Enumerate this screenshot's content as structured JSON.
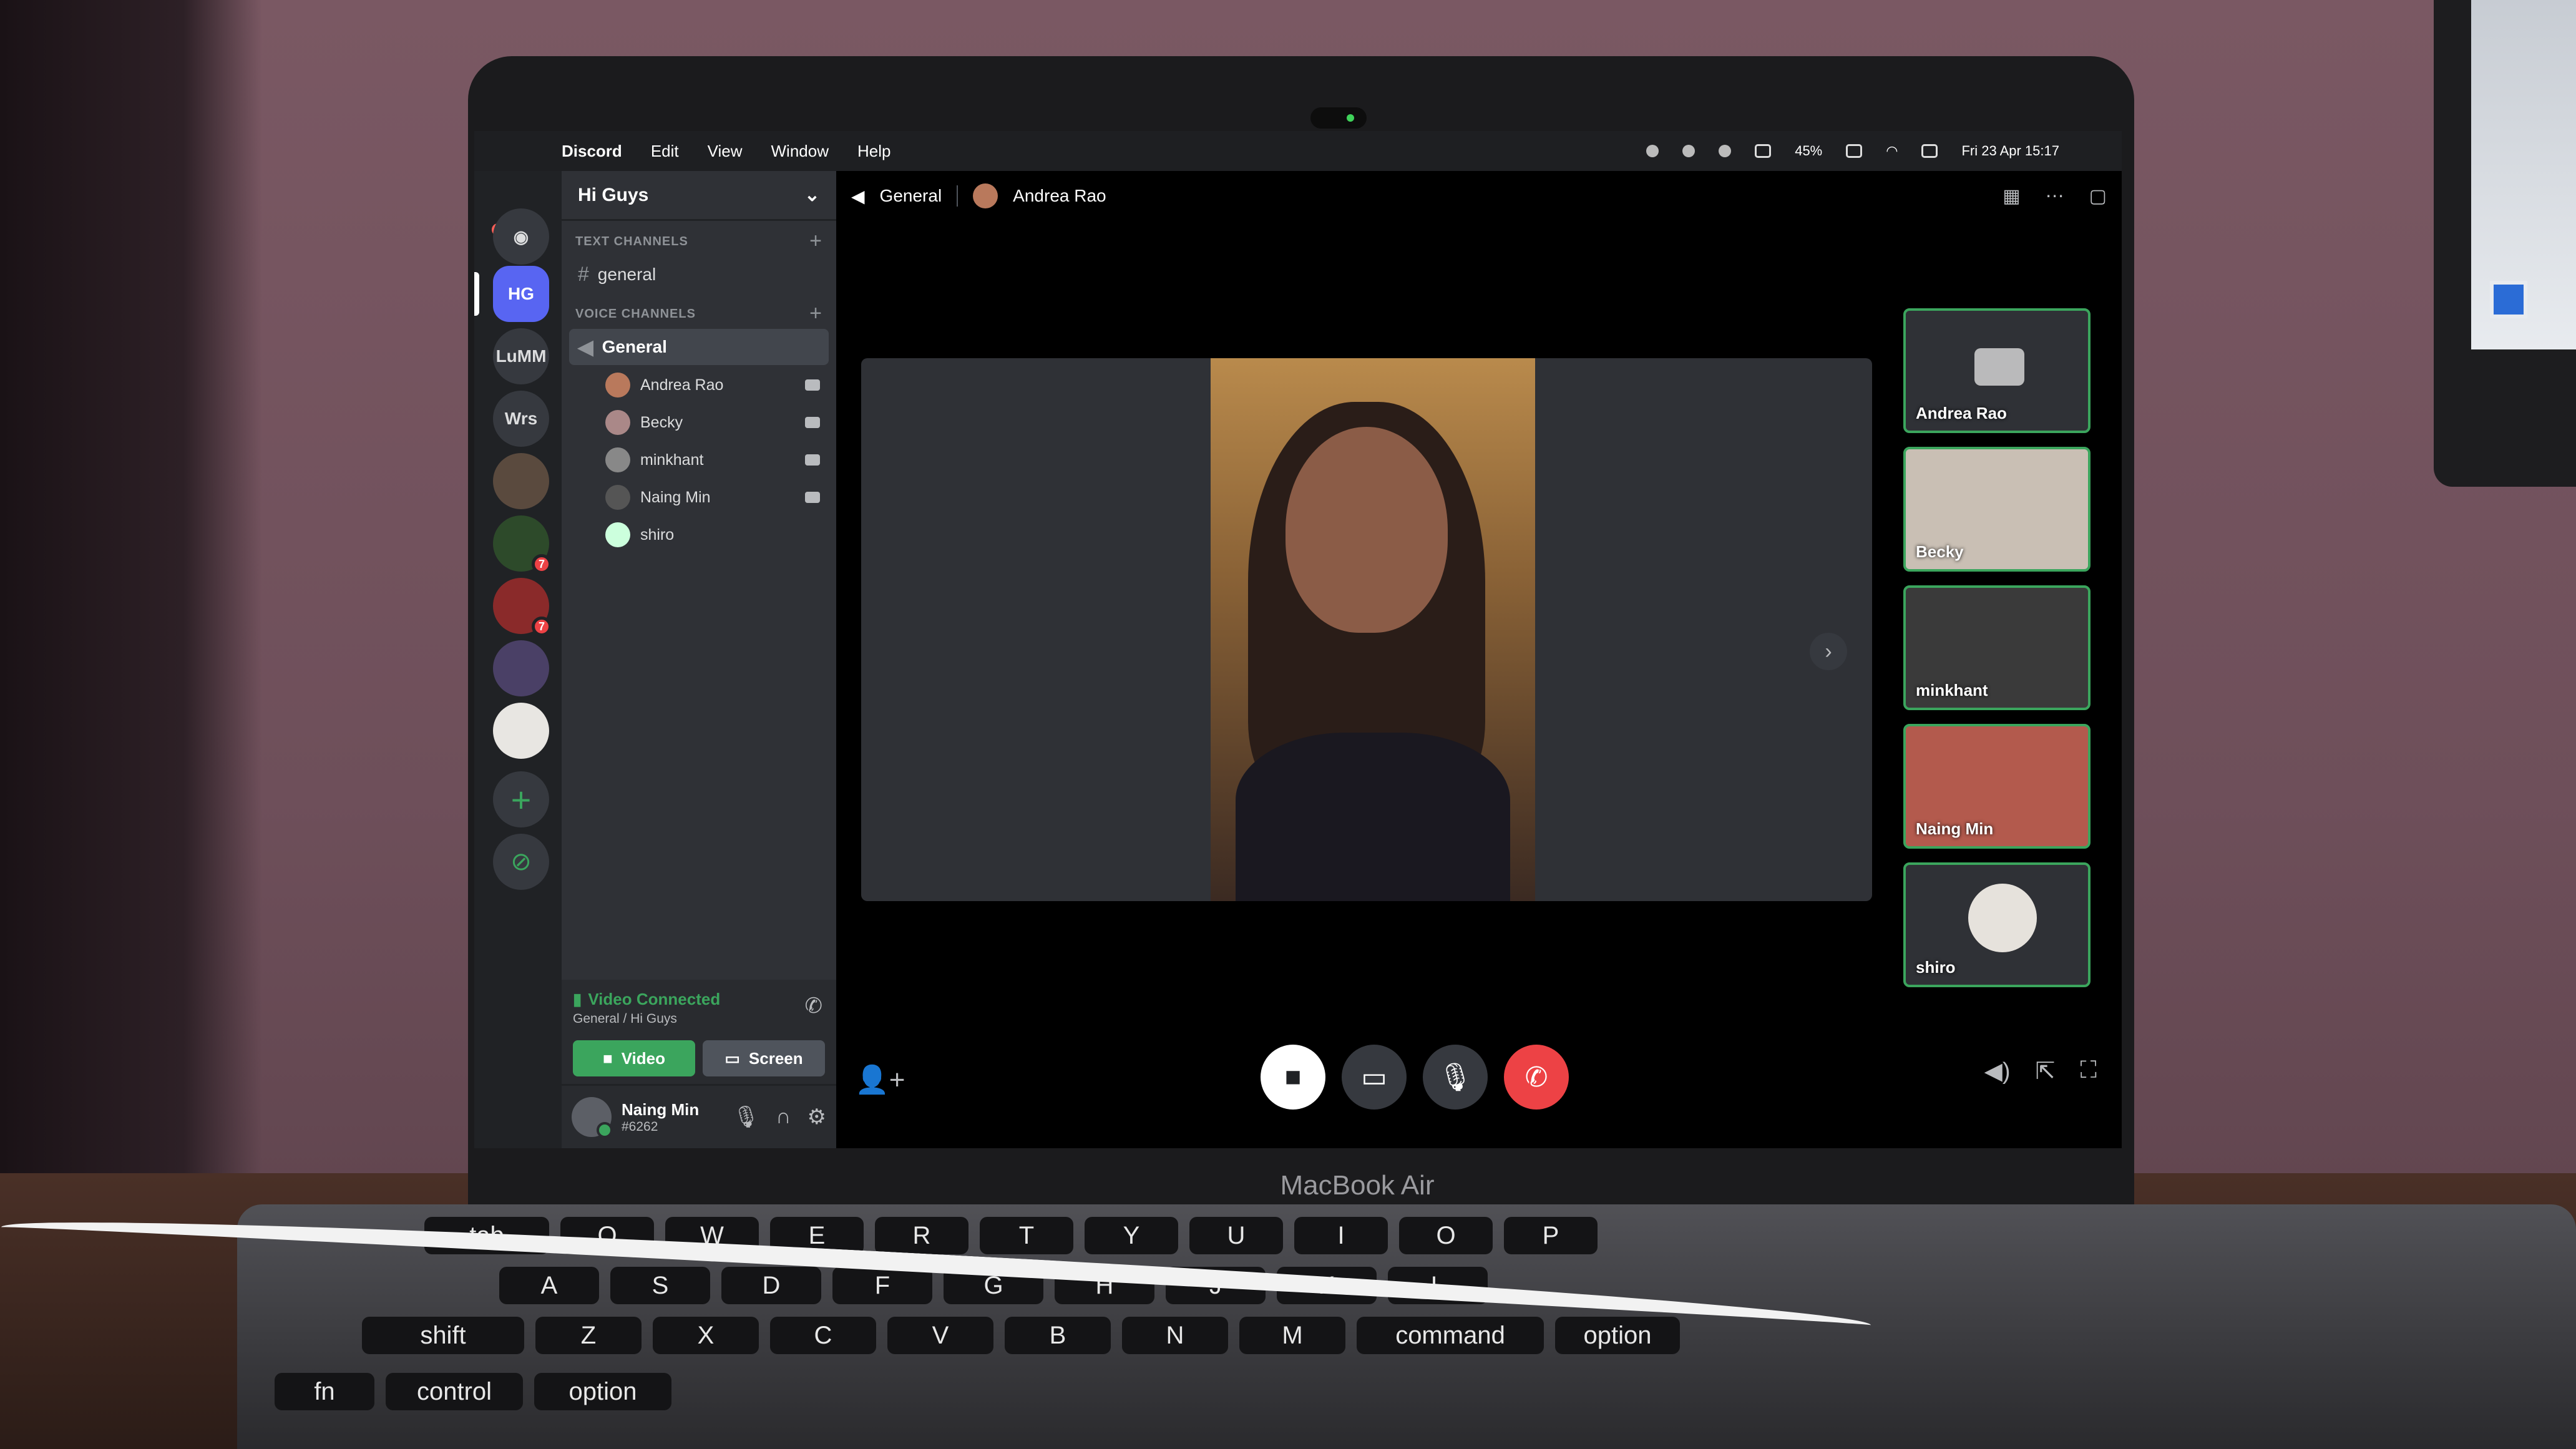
{
  "menubar": {
    "app": "Discord",
    "items": [
      "Edit",
      "View",
      "Window",
      "Help"
    ],
    "battery": "45%",
    "datetime": "Fri 23 Apr  15:17"
  },
  "servers": [
    "HG",
    "LuMM",
    "Wrs"
  ],
  "guild": {
    "name": "Hi Guys"
  },
  "text_channels": {
    "label": "TEXT CHANNELS",
    "channels": [
      "general"
    ]
  },
  "voice_channels": {
    "label": "VOICE CHANNELS",
    "channel": "General",
    "users": [
      "Andrea Rao",
      "Becky",
      "minkhant",
      "Naing Min",
      "shiro"
    ]
  },
  "voice_panel": {
    "status": "Video Connected",
    "location": "General / Hi Guys",
    "video_label": "Video",
    "screen_label": "Screen"
  },
  "user": {
    "name": "Naing Min",
    "tag": "#6262"
  },
  "stage": {
    "channel": "General",
    "focused_user": "Andrea Rao",
    "tiles": [
      "Andrea Rao",
      "Becky",
      "minkhant",
      "Naing Min",
      "shiro"
    ]
  },
  "bezel": {
    "label": "MacBook Air"
  },
  "keyboard": {
    "row1": [
      "tab",
      "Q",
      "W",
      "E",
      "R",
      "T",
      "Y",
      "U",
      "I",
      "O",
      "P"
    ],
    "row2": [
      "A",
      "S",
      "D",
      "F",
      "G",
      "H",
      "J",
      "K",
      "L"
    ],
    "row3": [
      "shift",
      "Z",
      "X",
      "C",
      "V",
      "B",
      "N",
      "M",
      "command",
      "option"
    ],
    "row4": [
      "fn",
      "control",
      "option"
    ]
  },
  "colors": {
    "accent": "#5865f2",
    "green": "#3ba55d",
    "red": "#ed4245"
  }
}
